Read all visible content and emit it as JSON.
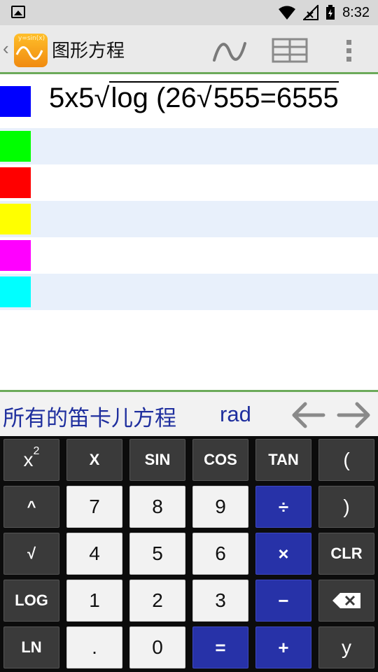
{
  "status_bar": {
    "time": "8:32"
  },
  "app_bar": {
    "title": "图形方程",
    "logo_text": "y=sin(x)",
    "icons": [
      "back-chevron-icon",
      "app-logo-icon",
      "graph-wave-icon",
      "table-icon",
      "overflow-menu-icon"
    ]
  },
  "equations": [
    {
      "color": "#0000ff",
      "parts": {
        "a": "5x5",
        "b": "log (26",
        "c": "555=6555"
      }
    },
    {
      "color": "#00ff00"
    },
    {
      "color": "#ff0000"
    },
    {
      "color": "#ffff00"
    },
    {
      "color": "#ff00ff"
    },
    {
      "color": "#00ffff"
    }
  ],
  "mode_bar": {
    "label": "所有的笛卡儿方程",
    "angle_unit": "rad"
  },
  "keypad": {
    "row1": [
      "x",
      "X",
      "SIN",
      "COS",
      "TAN",
      "("
    ],
    "x_squared_sup": "2",
    "row2": [
      "^",
      "7",
      "8",
      "9",
      "÷",
      ")"
    ],
    "row3": [
      "√",
      "4",
      "5",
      "6",
      "×",
      "CLR"
    ],
    "row4": [
      "LOG",
      "1",
      "2",
      "3",
      "−",
      "⌫"
    ],
    "row5": [
      "LN",
      ".",
      "0",
      "=",
      "+",
      "y"
    ]
  },
  "colors": {
    "accent_green": "#6caa5a",
    "key_blue": "#2732a8",
    "label_blue": "#1f2f9e"
  }
}
